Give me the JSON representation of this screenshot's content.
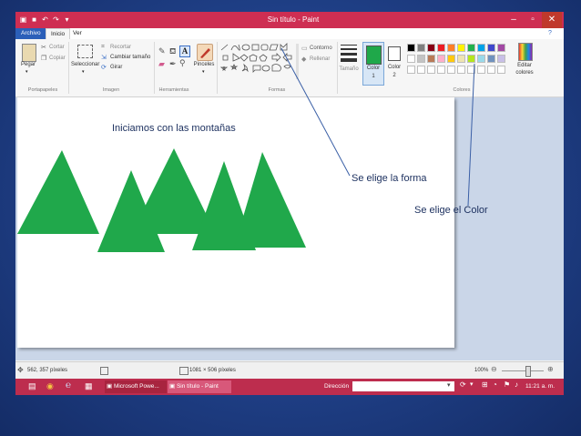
{
  "window": {
    "title": "Sin título - Paint"
  },
  "tabs": [
    "Archivo",
    "Inicio",
    "Ver"
  ],
  "clipboard": {
    "paste": "Pegar",
    "cut": "Cortar",
    "copy": "Copiar",
    "label": "Portapapeles"
  },
  "image": {
    "select": "Seleccionar",
    "crop": "Recortar",
    "resize": "Cambiar tamaño",
    "rotate": "Girar",
    "label": "Imagen"
  },
  "tools": {
    "label": "Herramientas",
    "text_tool": "A"
  },
  "brushes": {
    "label": "Pinceles"
  },
  "shapes": {
    "outline": "Contorno",
    "fill": "Rellenar",
    "label": "Formas"
  },
  "size": {
    "label": "Tamaño"
  },
  "colors": {
    "color1_label": "Color",
    "color1_num": "1",
    "color2_label": "Color",
    "color2_num": "2",
    "edit_label": "Editar colores",
    "label": "Colores",
    "color1_value": "#1fa84a",
    "color2_value": "#ffffff",
    "palette_row1": [
      "#000000",
      "#7f7f7f",
      "#880015",
      "#ed1c24",
      "#ff7f27",
      "#fff200",
      "#22b14c",
      "#00a2e8",
      "#3f48cc",
      "#a349a4"
    ],
    "palette_row2": [
      "#ffffff",
      "#c3c3c3",
      "#b97a57",
      "#ffaec9",
      "#ffc90e",
      "#efe4b0",
      "#b5e61d",
      "#99d9ea",
      "#7092be",
      "#c8bfe7"
    ]
  },
  "status": {
    "position": "562, 357 píxeles",
    "dimensions": "1081 × 506 píxeles",
    "zoom": "100%"
  },
  "taskbar": {
    "app1": "Microsoft Powe...",
    "app2": "Sin título - Paint",
    "address_label": "Dirección",
    "clock": "11:21 a. m."
  },
  "annotations": {
    "mountains": "Iniciamos con las montañas",
    "shape": "Se elige la forma",
    "color": "Se elige el Color"
  }
}
